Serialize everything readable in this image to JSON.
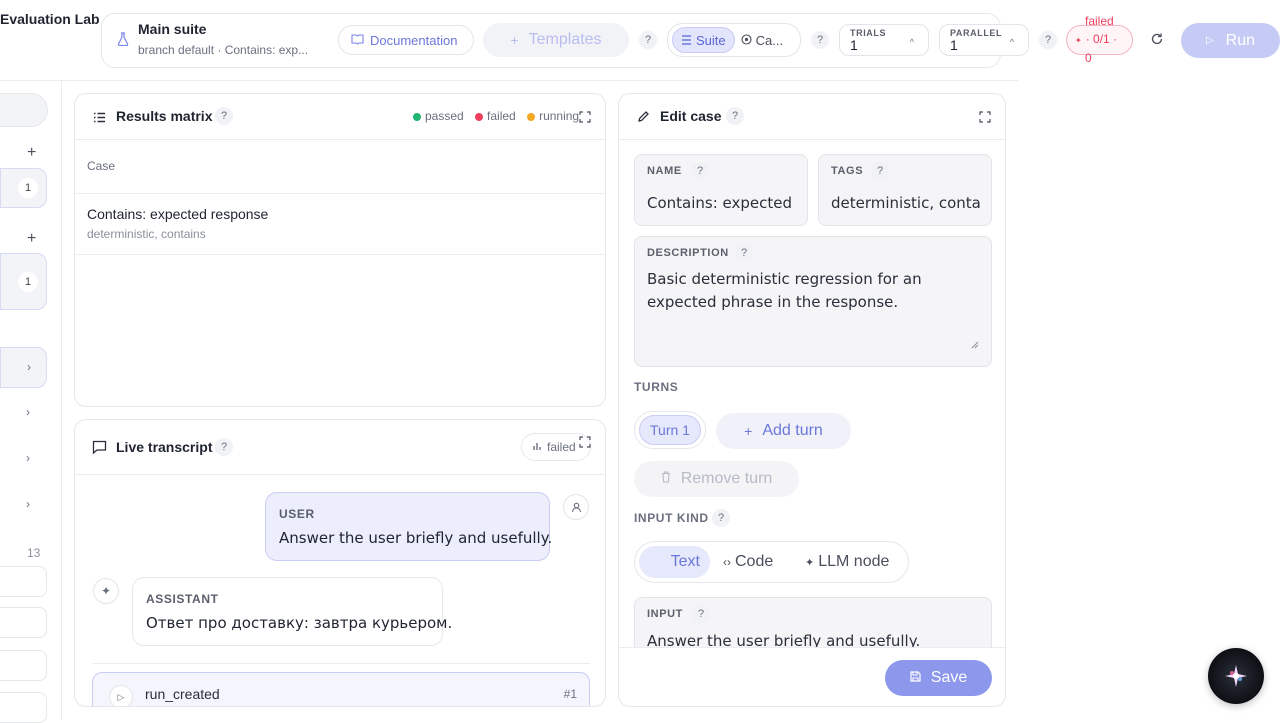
{
  "app": {
    "title": "Evaluation Lab"
  },
  "header": {
    "suite_name": "Main suite",
    "suite_sub": "branch default · Contains: exp...",
    "documentation_label": "Documentation",
    "templates_label": "Templates",
    "view_suite_label": "Suite",
    "view_case_label": "Ca...",
    "trials_label": "TRIALS",
    "trials_value": "1",
    "parallel_label": "PARALLEL",
    "parallel_value": "1",
    "status_failed": "failed",
    "status_count": "· 0/1 ·",
    "status_zero": "0",
    "run_label": "Run",
    "help": "?"
  },
  "sidebar": {
    "badge_1": "1",
    "badge_2": "1",
    "count": "13"
  },
  "results": {
    "title": "Results matrix",
    "legend_passed": "passed",
    "legend_failed": "failed",
    "legend_running": "running",
    "column_case": "Case",
    "rows": [
      {
        "name": "Contains: expected response",
        "tags": "deterministic, contains"
      }
    ]
  },
  "transcript": {
    "title": "Live transcript",
    "status": "failed",
    "messages": [
      {
        "role": "USER",
        "text": "Answer the user briefly and usefully."
      },
      {
        "role": "ASSISTANT",
        "text": "Ответ про доставку: завтра курьером."
      }
    ],
    "event_name": "run_created",
    "event_id": "#1"
  },
  "edit": {
    "title": "Edit case",
    "name_label": "NAME",
    "name_value": "Contains: expected r",
    "tags_label": "TAGS",
    "tags_value": "deterministic, contair",
    "description_label": "DESCRIPTION",
    "description_value": "Basic deterministic regression for an expected phrase in the response.",
    "turns_label": "TURNS",
    "turn_1": "Turn 1",
    "add_turn": "Add turn",
    "remove_turn": "Remove turn",
    "input_kind_label": "INPUT KIND",
    "kind_text": "Text",
    "kind_code": "Code",
    "kind_llm": "LLM node",
    "input_label": "INPUT",
    "input_value": "Answer the user briefly and usefully.",
    "save_label": "Save"
  },
  "colors": {
    "accent": "#7b86e8",
    "accent_soft": "#e8eafb",
    "passed": "#22b573",
    "failed": "#ef3e5c",
    "running": "#f5a623"
  }
}
